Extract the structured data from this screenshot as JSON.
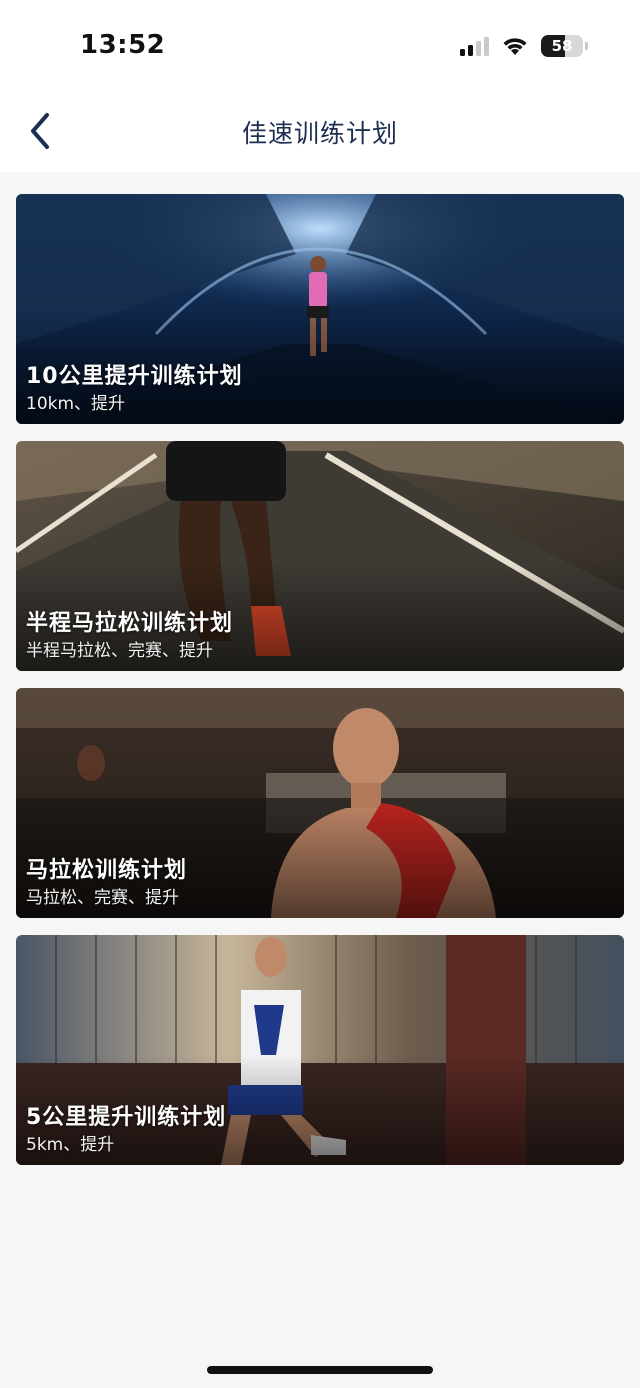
{
  "status_bar": {
    "time": "13:52",
    "battery": "58",
    "battery_level": 0.58,
    "icons": [
      "cellular-signal-icon",
      "wifi-icon",
      "battery-icon"
    ]
  },
  "nav": {
    "title": "佳速训练计划",
    "back_icon": "chevron-left-icon"
  },
  "plans": [
    {
      "title": "10公里提升训练计划",
      "tags": "10km、提升"
    },
    {
      "title": "半程马拉松训练计划",
      "tags": "半程马拉松、完赛、提升"
    },
    {
      "title": "马拉松训练计划",
      "tags": "马拉松、完赛、提升"
    },
    {
      "title": "5公里提升训练计划",
      "tags": "5km、提升"
    }
  ],
  "colors": {
    "title_text": "#1c2f52",
    "background": "#f6f6f7"
  }
}
